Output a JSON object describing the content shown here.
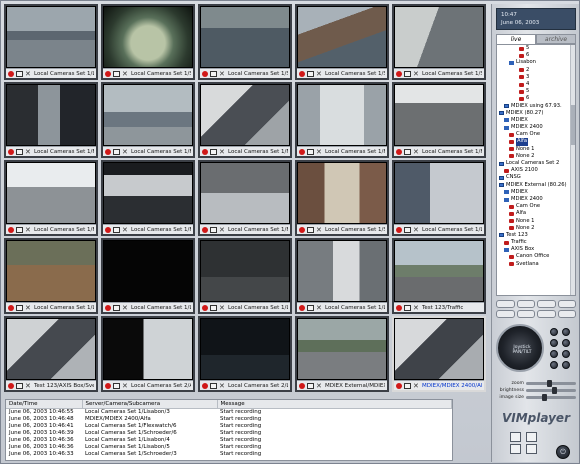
{
  "clock": {
    "time": "10:47",
    "date": "June 06, 2003"
  },
  "tabs": [
    {
      "label": "live",
      "active": true
    },
    {
      "label": "archive",
      "active": false
    }
  ],
  "grid": {
    "cameras": [
      {
        "caption": "Local Cameras Set 1/Lo",
        "scene": "street"
      },
      {
        "caption": "Local Cameras Set 1/Sc",
        "scene": "fisheye"
      },
      {
        "caption": "Local Cameras Set 1/Sc",
        "scene": "parking"
      },
      {
        "caption": "Local Cameras Set 1/Sc",
        "scene": "roofs"
      },
      {
        "caption": "Local Cameras Set 1/Sc",
        "scene": "lobby"
      },
      {
        "caption": "Local Cameras Set 1/Flo",
        "scene": "door"
      },
      {
        "caption": "Local Cameras Set 1/Fla",
        "scene": "harbor"
      },
      {
        "caption": "Local Cameras Set 1/Mi",
        "scene": "desk"
      },
      {
        "caption": "Local Cameras Set 1/Fla",
        "scene": "corridor"
      },
      {
        "caption": "Local Cameras Set 1/Fla",
        "scene": "yard"
      },
      {
        "caption": "Local Cameras Set 1/Fla",
        "scene": "snow"
      },
      {
        "caption": "Local Cameras Set 1/Fla",
        "scene": "porch"
      },
      {
        "caption": "Local Cameras Set 1/Fla",
        "scene": "room"
      },
      {
        "caption": "Local Cameras Set 1/Sc",
        "scene": "shop"
      },
      {
        "caption": "Local Cameras Set 1/Lo",
        "scene": "hall"
      },
      {
        "caption": "Local Cameras Set 1/Lo",
        "scene": "office"
      },
      {
        "caption": "Local Cameras Set 1/Lo",
        "scene": "black"
      },
      {
        "caption": "Local Cameras Set 1/Lo",
        "scene": "dark"
      },
      {
        "caption": "Local Cameras Set 1/Lo",
        "scene": "kitchen"
      },
      {
        "caption": "Test 123/Traffic",
        "scene": "traffic"
      },
      {
        "caption": "Test 123/AXIS Box/Sve",
        "scene": "desk2"
      },
      {
        "caption": "Local Cameras Set 2/AX",
        "scene": "monitor"
      },
      {
        "caption": "Local Cameras Set 2/Lo",
        "scene": "night"
      },
      {
        "caption": "MDIEX External/MDIEX",
        "scene": "road"
      },
      {
        "caption": "MDIEX/MDIEX 2400/Alfa",
        "scene": "desk3",
        "selected": true
      }
    ]
  },
  "log": {
    "columns": [
      "Date/Time",
      "Server/Camera/Subcamera",
      "Message"
    ],
    "rows": [
      [
        "June 06, 2003 10:46:55",
        "Local Cameras Set 1/Lisabon/3",
        "Start recording"
      ],
      [
        "June 06, 2003 10:46:48",
        "MDIEX/MDIEX 2400/Alfa",
        "Start recording"
      ],
      [
        "June 06, 2003 10:46:41",
        "Local Cameras Set 1/Flexwatch/6",
        "Start recording"
      ],
      [
        "June 06, 2003 10:46:39",
        "Local Cameras Set 1/Schroeder/6",
        "Start recording"
      ],
      [
        "June 06, 2003 10:46:36",
        "Local Cameras Set 1/Lisabon/4",
        "Start recording"
      ],
      [
        "June 06, 2003 10:46:36",
        "Local Cameras Set 1/Lisabon/5",
        "Start recording"
      ],
      [
        "June 06, 2003 10:46:33",
        "Local Cameras Set 1/Schroeder/3",
        "Start recording"
      ]
    ]
  },
  "tree": [
    {
      "label": "5",
      "indent": 4,
      "icon": "cam"
    },
    {
      "label": "6",
      "indent": 4,
      "icon": "cam"
    },
    {
      "label": "Lisabon",
      "indent": 2,
      "icon": "folder"
    },
    {
      "label": "2",
      "indent": 4,
      "icon": "cam"
    },
    {
      "label": "3",
      "indent": 4,
      "icon": "cam"
    },
    {
      "label": "4",
      "indent": 4,
      "icon": "cam"
    },
    {
      "label": "5",
      "indent": 4,
      "icon": "cam"
    },
    {
      "label": "6",
      "indent": 4,
      "icon": "cam"
    },
    {
      "label": "MDIEX using 67.93.",
      "indent": 1,
      "icon": "srv"
    },
    {
      "label": "MDIEX (80.27)",
      "indent": 0,
      "icon": "srv"
    },
    {
      "label": "MDIEX",
      "indent": 1,
      "icon": "folder"
    },
    {
      "label": "MDIEX 2400",
      "indent": 1,
      "icon": "folder"
    },
    {
      "label": "Cam One",
      "indent": 2,
      "icon": "cam"
    },
    {
      "label": "Alfa",
      "indent": 2,
      "icon": "cam",
      "selected": true
    },
    {
      "label": "None 1",
      "indent": 2,
      "icon": "cam"
    },
    {
      "label": "None 2",
      "indent": 2,
      "icon": "cam"
    },
    {
      "label": "Local Cameras Set 2",
      "indent": 0,
      "icon": "srv"
    },
    {
      "label": "AXIS 2100",
      "indent": 1,
      "icon": "cam"
    },
    {
      "label": "CNSG",
      "indent": 0,
      "icon": "srv"
    },
    {
      "label": "MDIEX External (80.26)",
      "indent": 0,
      "icon": "srv"
    },
    {
      "label": "MDIEX",
      "indent": 1,
      "icon": "folder"
    },
    {
      "label": "MDIEX 2400",
      "indent": 1,
      "icon": "folder"
    },
    {
      "label": "Cam One",
      "indent": 2,
      "icon": "cam"
    },
    {
      "label": "Alfa",
      "indent": 2,
      "icon": "cam"
    },
    {
      "label": "None 1",
      "indent": 2,
      "icon": "cam"
    },
    {
      "label": "None 2",
      "indent": 2,
      "icon": "cam"
    },
    {
      "label": "Test 123",
      "indent": 0,
      "icon": "srv"
    },
    {
      "label": "Traffic",
      "indent": 1,
      "icon": "cam"
    },
    {
      "label": "AXIS Box",
      "indent": 1,
      "icon": "folder"
    },
    {
      "label": "Canon Office",
      "indent": 2,
      "icon": "cam"
    },
    {
      "label": "Svetlana",
      "indent": 2,
      "icon": "cam"
    }
  ],
  "ptz": {
    "joystick_label": "Joystick",
    "joystick_sublabel": "PAN/TILT"
  },
  "sliders": [
    {
      "label": "zoom",
      "value": 0.45
    },
    {
      "label": "brightness",
      "value": 0.55
    },
    {
      "label": "image size",
      "value": 0.35
    }
  ],
  "brand": "VIMplayer",
  "colors": {
    "recording": "#d01818",
    "selection": "#1d3f8f",
    "panel": "#c9cdd4"
  }
}
